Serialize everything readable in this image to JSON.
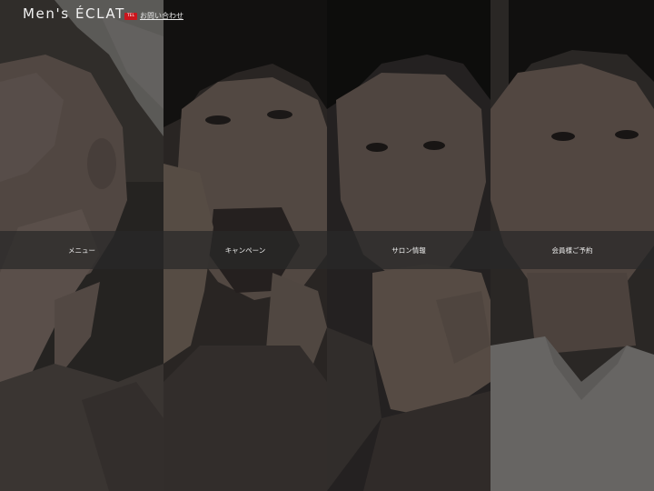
{
  "header": {
    "logo": "Men's ÉCLAT",
    "tel_badge": "TEL",
    "contact_link": "お問い合わせ"
  },
  "nav": {
    "items": [
      {
        "label": "メニュー"
      },
      {
        "label": "キャンペーン"
      },
      {
        "label": "サロン情報"
      },
      {
        "label": "会員様ご予約"
      }
    ]
  },
  "colors": {
    "tel_badge": "#c9161d",
    "nav_bar": "#282828",
    "text": "#efefef"
  }
}
